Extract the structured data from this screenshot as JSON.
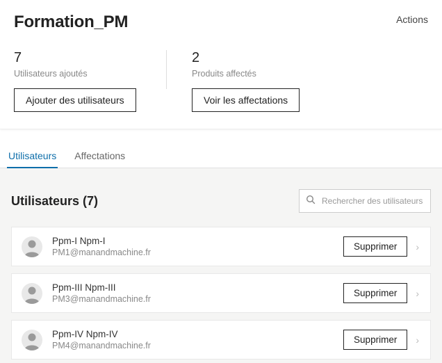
{
  "header": {
    "title": "Formation_PM",
    "actions_label": "Actions"
  },
  "stats": {
    "users": {
      "count": "7",
      "label": "Utilisateurs ajoutés",
      "button": "Ajouter des utilisateurs"
    },
    "products": {
      "count": "2",
      "label": "Produits affectés",
      "button": "Voir les affectations"
    }
  },
  "tabs": {
    "users": "Utilisateurs",
    "assignments": "Affectations"
  },
  "list": {
    "title": "Utilisateurs (7)",
    "search_placeholder": "Rechercher des utilisateurs",
    "remove_label": "Supprimer",
    "users": [
      {
        "name": "Ppm-I Npm-I",
        "email": "PM1@manandmachine.fr"
      },
      {
        "name": "Ppm-III Npm-III",
        "email": "PM3@manandmachine.fr"
      },
      {
        "name": "Ppm-IV Npm-IV",
        "email": "PM4@manandmachine.fr"
      }
    ]
  }
}
